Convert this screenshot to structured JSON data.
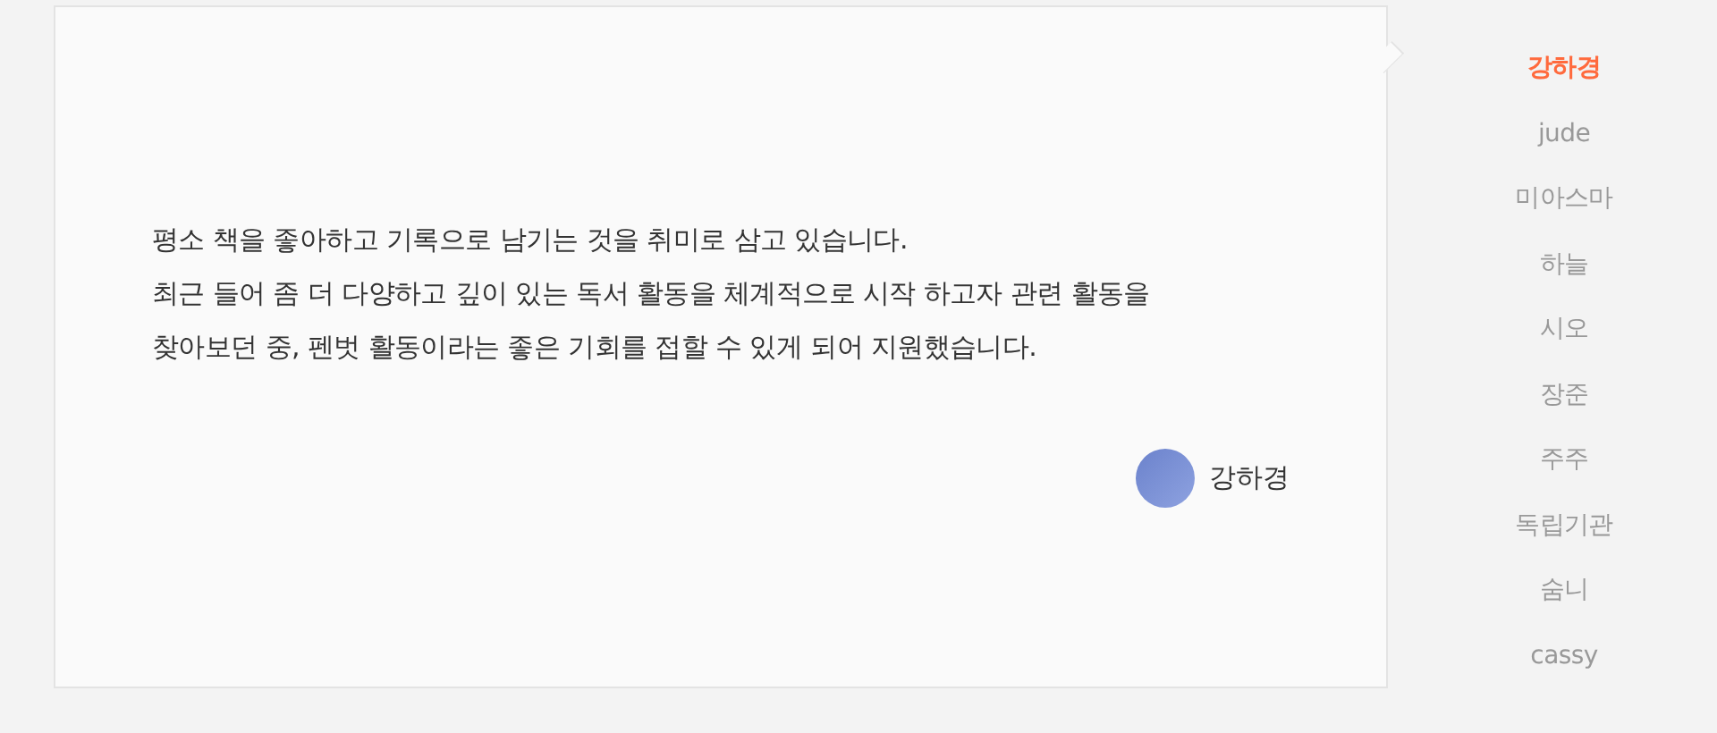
{
  "review": {
    "lines": [
      "평소 책을 좋아하고 기록으로 남기는 것을 취미로 삼고 있습니다.",
      "최근 들어 좀 더 다양하고 깊이 있는 독서 활동을 체계적으로 시작 하고자 관련 활동을",
      "찾아보던 중, 펜벗 활동이라는 좋은 기회를 접할 수 있게 되어 지원했습니다."
    ],
    "author": "강하경"
  },
  "members": [
    {
      "name": "강하경",
      "selected": true
    },
    {
      "name": "jude",
      "selected": false
    },
    {
      "name": "미아스마",
      "selected": false
    },
    {
      "name": "하늘",
      "selected": false
    },
    {
      "name": "시오",
      "selected": false
    },
    {
      "name": "장준",
      "selected": false
    },
    {
      "name": "주주",
      "selected": false
    },
    {
      "name": "독립기관",
      "selected": false
    },
    {
      "name": "숨니",
      "selected": false
    },
    {
      "name": "cassy",
      "selected": false
    }
  ]
}
